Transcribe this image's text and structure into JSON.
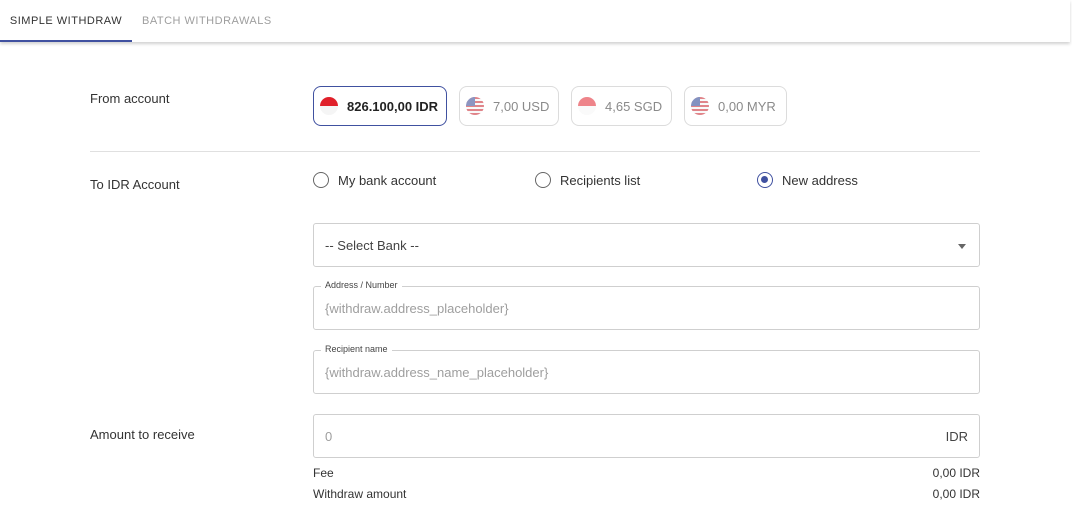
{
  "tabs": [
    {
      "label": "Simple Withdraw",
      "active": true
    },
    {
      "label": "Batch Withdrawals",
      "active": false
    }
  ],
  "colors": {
    "accent": "#4051a0",
    "border": "#cfcfcf",
    "muted": "#9e9e9e"
  },
  "from_account": {
    "label": "From account",
    "accounts": [
      {
        "amount": "826.100,00 IDR",
        "flag": "indonesia-flag-icon",
        "selected": true
      },
      {
        "amount": "7,00 USD",
        "flag": "usa-flag-icon",
        "selected": false
      },
      {
        "amount": "4,65 SGD",
        "flag": "singapore-flag-icon",
        "selected": false
      },
      {
        "amount": "0,00 MYR",
        "flag": "malaysia-flag-icon",
        "selected": false
      }
    ]
  },
  "to_account": {
    "label": "To IDR Account",
    "options": [
      {
        "label": "My bank account",
        "checked": false
      },
      {
        "label": "Recipients list",
        "checked": false
      },
      {
        "label": "New address",
        "checked": true
      }
    ],
    "bank_select": {
      "value": "-- Select Bank --",
      "icon": "chevron-down-icon"
    },
    "address": {
      "legend": "Address / Number",
      "placeholder": "{withdraw.address_placeholder}"
    },
    "recipient": {
      "legend": "Recipient name",
      "placeholder": "{withdraw.address_name_placeholder}"
    }
  },
  "amount": {
    "label": "Amount to receive",
    "value": "0",
    "currency": "IDR"
  },
  "summary": {
    "fee_label": "Fee",
    "fee_value": "0,00 IDR",
    "withdraw_label": "Withdraw amount",
    "withdraw_value": "0,00 IDR"
  }
}
